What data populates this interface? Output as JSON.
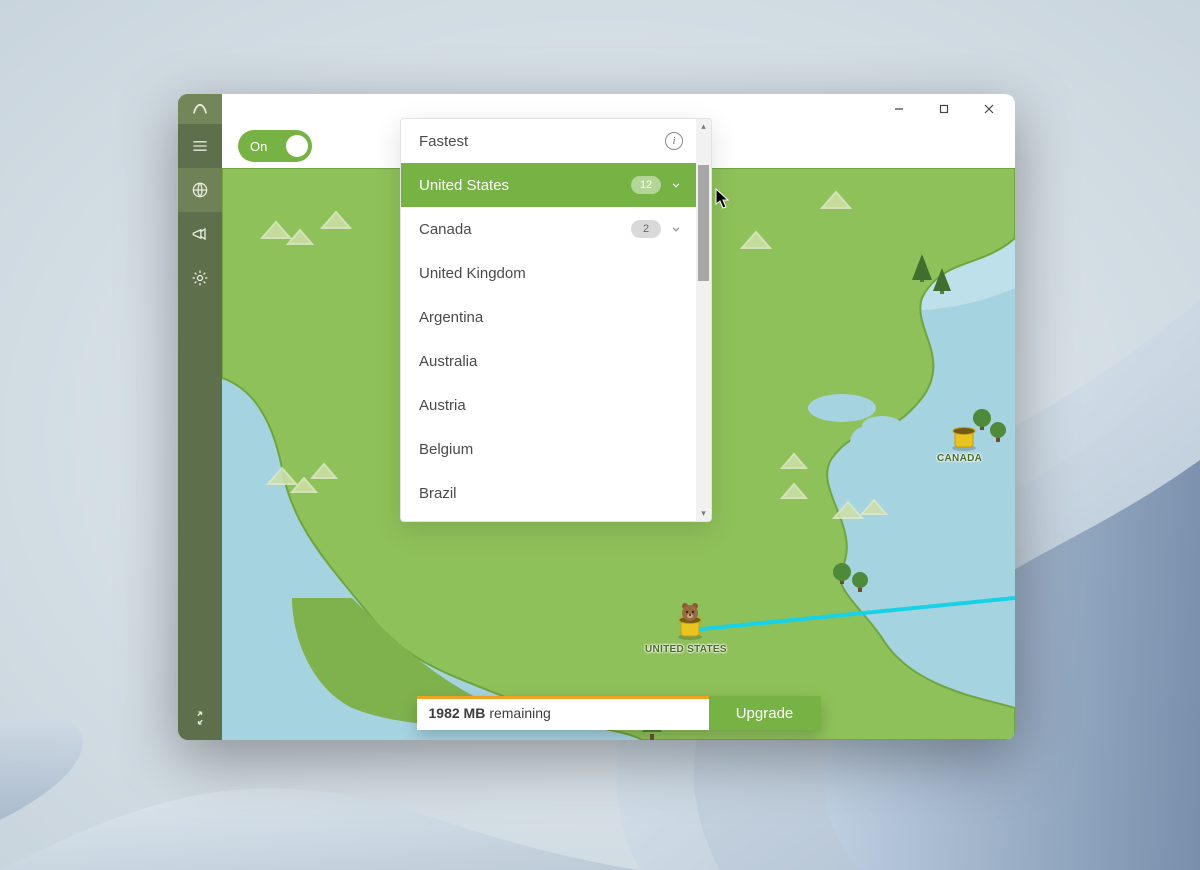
{
  "window": {
    "toggle_label": "On"
  },
  "sidebar": {
    "items": [
      "menu",
      "globe",
      "announce",
      "settings"
    ],
    "active_index": 1
  },
  "dropdown": {
    "items": [
      {
        "label": "Fastest",
        "info": true
      },
      {
        "label": "United States",
        "count": "12",
        "expandable": true,
        "selected": true
      },
      {
        "label": "Canada",
        "count": "2",
        "expandable": true
      },
      {
        "label": "United Kingdom"
      },
      {
        "label": "Argentina"
      },
      {
        "label": "Australia"
      },
      {
        "label": "Austria"
      },
      {
        "label": "Belgium"
      },
      {
        "label": "Brazil"
      }
    ]
  },
  "map": {
    "pins": [
      {
        "id": "canada",
        "label": "CANADA"
      },
      {
        "id": "united-states",
        "label": "UNITED STATES"
      }
    ]
  },
  "status": {
    "amount": "1982 MB",
    "remaining_label": "remaining",
    "upgrade_label": "Upgrade"
  }
}
